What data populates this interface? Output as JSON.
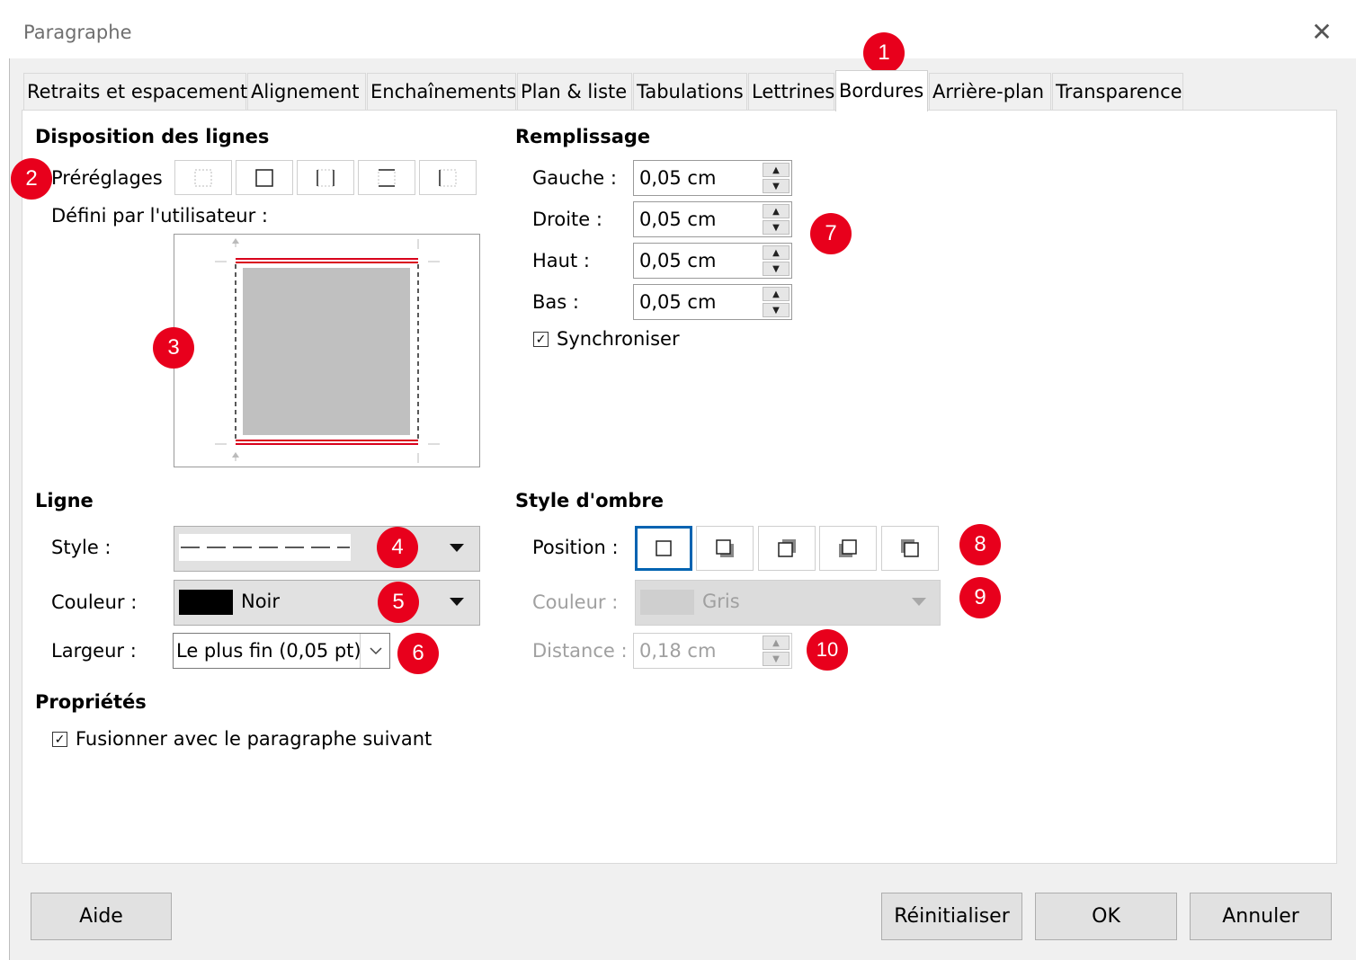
{
  "window": {
    "title": "Paragraphe",
    "close_symbol": "✕"
  },
  "tabs": [
    {
      "label": "Retraits et espacement"
    },
    {
      "label": "Alignement"
    },
    {
      "label": "Enchaînements"
    },
    {
      "label": "Plan & liste"
    },
    {
      "label": "Tabulations"
    },
    {
      "label": "Lettrines"
    },
    {
      "label": "Bordures",
      "active": true
    },
    {
      "label": "Arrière-plan"
    },
    {
      "label": "Transparence"
    }
  ],
  "line_arrangement": {
    "heading": "Disposition des lignes",
    "presets_label": "Préréglages",
    "user_defined_label": "Défini par l'utilisateur :"
  },
  "padding": {
    "heading": "Remplissage",
    "left": {
      "label": "Gauche :",
      "value": "0,05 cm"
    },
    "right": {
      "label": "Droite :",
      "value": "0,05 cm"
    },
    "top": {
      "label": "Haut :",
      "value": "0,05 cm"
    },
    "bottom": {
      "label": "Bas :",
      "value": "0,05 cm"
    },
    "synchronize": {
      "label": "Synchroniser",
      "checked": true
    }
  },
  "line": {
    "heading": "Ligne",
    "style_label": "Style :",
    "color_label": "Couleur :",
    "color_value": "Noir",
    "color_swatch": "#000000",
    "width_label": "Largeur :",
    "width_value": "Le plus fin (0,05 pt)"
  },
  "shadow": {
    "heading": "Style d'ombre",
    "position_label": "Position :",
    "color_label": "Couleur :",
    "color_value": "Gris",
    "distance_label": "Distance :",
    "distance_value": "0,18 cm"
  },
  "properties": {
    "heading": "Propriétés",
    "merge": {
      "label": "Fusionner avec le paragraphe suivant",
      "checked": true
    }
  },
  "buttons": {
    "help": "Aide",
    "reset": "Réinitialiser",
    "ok": "OK",
    "cancel": "Annuler"
  },
  "callouts": [
    "1",
    "2",
    "3",
    "4",
    "5",
    "6",
    "7",
    "8",
    "9",
    "10"
  ],
  "colors": {
    "accent_selected": "#0063b1",
    "callout_red": "#e8001c",
    "preview_gray": "#c0c0c0",
    "border_red": "#d9001b"
  }
}
